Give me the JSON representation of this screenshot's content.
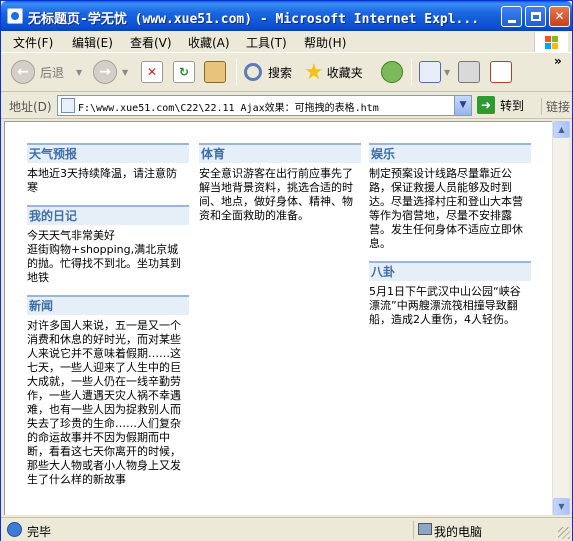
{
  "window": {
    "title": "无标题页-学无忧 (www.xue51.com) - Microsoft Internet Expl...",
    "min_glyph": "_",
    "max_glyph": "□",
    "close_glyph": "✕"
  },
  "menu": [
    "文件(F)",
    "编辑(E)",
    "查看(V)",
    "收藏(A)",
    "工具(T)",
    "帮助(H)"
  ],
  "toolbar": {
    "back_label": "后退",
    "search_label": "搜索",
    "favorites_label": "收藏夹",
    "back_glyph": "←",
    "forward_glyph": "→",
    "chevron": "»"
  },
  "address": {
    "label": "地址(D)",
    "value": "F:\\www.xue51.com\\C22\\22.11  Ajax效果：可拖拽的表格.htm",
    "go_label": "转到",
    "links_label": "链接"
  },
  "content": {
    "col1": [
      {
        "title": "天气预报",
        "body": "本地近3天持续降温，请注意防寒"
      },
      {
        "title": "我的日记",
        "body": "今天天气非常美好\n逛街购物+shopping,满北京城的抛。忙得找不到北。坐功其到地铁"
      },
      {
        "title": "新闻",
        "body": "对许多国人来说，五一是又一个消费和休息的好时光，而对某些人来说它并不意味着假期……这七天，一些人迎来了人生中的巨大成就，一些人仍在一线辛勤劳作，一些人遭遇天灾人祸不幸遇难，也有一些人因为捉救别人而失去了珍贵的生命……人们复杂的命运故事并不因为假期而中断，看看这七天你离开的时候，那些大人物或者小人物身上又发生了什么样的新故事"
      }
    ],
    "col2": [
      {
        "title": "体育",
        "body": "安全意识游客在出行前应事先了解当地背景资料，挑选合适的时间、地点，做好身体、精神、物资和全面救助的准备。"
      }
    ],
    "col3": [
      {
        "title": "娱乐",
        "body": "制定预案设计线路尽量靠近公路，保证救援人员能够及时到达。尽量选择村庄和登山大本营等作为宿营地，尽量不安排露营。发生任何身体不适应立即休息。"
      },
      {
        "title": "八卦",
        "body": "5月1日下午武汉中山公园“峡谷漂流”中两艘漂流筏相撞导致翻船，造成2人重伤，4人轻伤。"
      }
    ]
  },
  "status": {
    "text": "完毕",
    "zone": "我的电脑"
  },
  "colors": {
    "title_bar": "#0B4FCF",
    "block_header_bg": "#E6EEF8",
    "block_header_text": "#3F6FA8"
  }
}
